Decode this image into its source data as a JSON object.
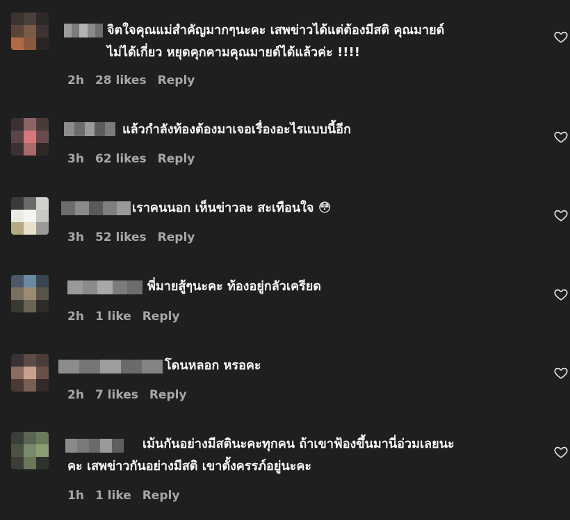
{
  "comments": [
    {
      "text": "จิตใจคุณแม่สำคัญมากๆนะคะ เสพข่าวได้แต่ต้องมีสติ คุณมายด์\nไม่ได้เกี่ยว หยุดคุกคามคุณมายด์ได้แล้วค่ะ !!!!",
      "time": "2h",
      "likes": "28 likes",
      "reply": "Reply",
      "avatar_colors": [
        "#3a3330",
        "#4a3f3a",
        "#2e2a2a",
        "#5a4438",
        "#7a5a48",
        "#3c3332",
        "#b06a48",
        "#8a5a40",
        "#2b2626"
      ],
      "name_colors": [
        "#9c9c9c",
        "#7c7c7c",
        "#b4b4b4",
        "#8a8a8a",
        "#6e6e6e"
      ]
    },
    {
      "text": "แล้วกำลังท้องต้องมาเจอเรื่องอะไรแบบนี้อีก",
      "time": "3h",
      "likes": "62 likes",
      "reply": "Reply",
      "avatar_colors": [
        "#3a3032",
        "#8c6466",
        "#4a3a3a",
        "#5a4546",
        "#d8777a",
        "#6a4a4c",
        "#3a3232",
        "#a86a6a",
        "#2e2828"
      ],
      "name_colors": [
        "#8c8c8c",
        "#6c6c6c",
        "#9a9a9a",
        "#5c5c5c",
        "#7a7a7a"
      ]
    },
    {
      "text": "เราคนนอก เห็นข่าวละ สะเทือนใจ 😳",
      "time": "3h",
      "likes": "52 likes",
      "reply": "Reply",
      "avatar_colors": [
        "#3a3a3a",
        "#6a6a66",
        "#d0d0cc",
        "#eaeae4",
        "#f4f4f0",
        "#c8c8c4",
        "#b6aa84",
        "#e8e0c8",
        "#9a9a96"
      ],
      "name_colors": [
        "#6c6c6c",
        "#8a8a8a",
        "#5a5a5a",
        "#7e7e7e",
        "#9a9a9a"
      ]
    },
    {
      "text": "พี่มายสู้ๆนะคะ ท้องอยู่กลัวเครียด",
      "time": "2h",
      "likes": "1 like",
      "reply": "Reply",
      "avatar_colors": [
        "#4a5868",
        "#6a88a0",
        "#3a4450",
        "#7a7060",
        "#9a8c74",
        "#5a5448",
        "#3a3832",
        "#6a6454",
        "#2e2c28"
      ],
      "name_colors": [
        "#9a9a9a",
        "#8a8a8a",
        "#a8a8a8",
        "#7c7c7c",
        "#6c6c6c"
      ]
    },
    {
      "text": "โดนหลอก หรอคะ",
      "time": "2h",
      "likes": "7 likes",
      "reply": "Reply",
      "avatar_colors": [
        "#3a3232",
        "#5c4a46",
        "#4a3c38",
        "#8a6c60",
        "#c8a090",
        "#6a5048",
        "#4a3a36",
        "#7a5e54",
        "#342a28"
      ],
      "name_colors": [
        "#8c8c8c",
        "#767676",
        "#9e9e9e",
        "#6a6a6a",
        "#848484"
      ]
    },
    {
      "text": "เม้นกันอย่างมีสตินะคะทุกคน ถ้าเขาฟ้องขึ้นมานี่อ่วมเลยนะ\nคะ เสพข่าวกันอย่างมีสติ เขาตั้งครรภ์อยู่นะคะ",
      "time": "1h",
      "likes": "1 like",
      "reply": "Reply",
      "avatar_colors": [
        "#3a4038",
        "#5a6454",
        "#6a7a5c",
        "#4a5244",
        "#7a8a6c",
        "#8aa070",
        "#3a3e36",
        "#6a7658",
        "#2e322c"
      ],
      "name_colors": [
        "#8a8a8a",
        "#7a7a7a",
        "#6a6a6a",
        "#9a9a9a",
        "#5e5e5e"
      ]
    }
  ],
  "icons": {
    "like": "heart-outline-icon"
  }
}
